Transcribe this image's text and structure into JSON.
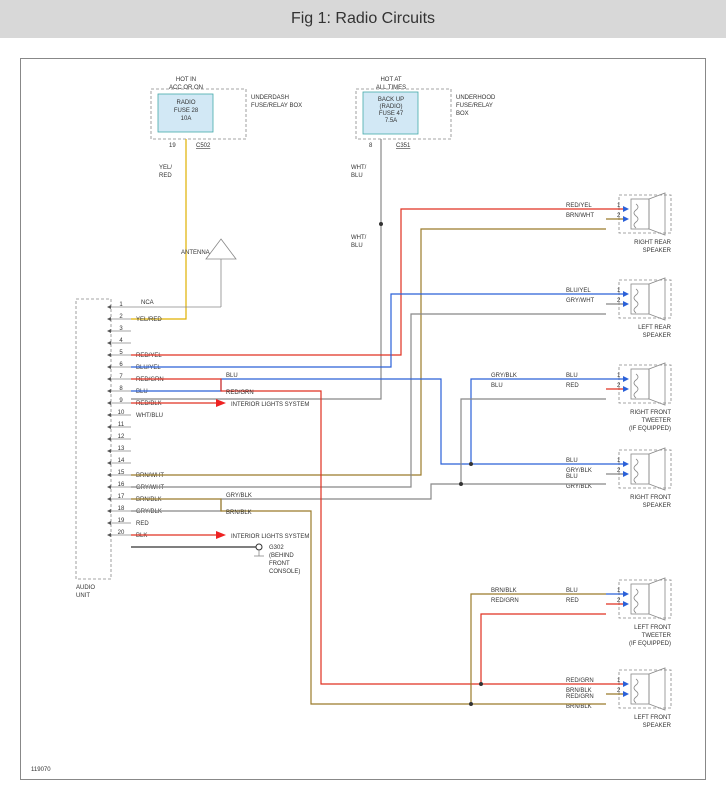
{
  "title": "Fig 1: Radio Circuits",
  "diagram_id": "119070",
  "fuse1": {
    "header": "HOT IN\nACC OR ON",
    "name": "RADIO",
    "fuse": "FUSE 28",
    "rating": "10A",
    "conn": "C502",
    "conn_pin": "19",
    "box_label": "UNDERDASH\nFUSE/RELAY BOX"
  },
  "fuse2": {
    "header": "HOT AT\nALL TIMES",
    "name": "BACK UP",
    "sub": "(RADIO)",
    "fuse": "FUSE 47",
    "rating": "7.5A",
    "conn": "C351",
    "conn_pin": "8",
    "box_label": "UNDERHOOD\nFUSE/RELAY\nBOX"
  },
  "antenna_label": "ANTENNA",
  "antenna_wire": "NCA",
  "audio_unit": "AUDIO\nUNIT",
  "ground": {
    "id": "G302",
    "loc": "(BEHIND\nFRONT\nCONSOLE)"
  },
  "interior_lights": "INTERIOR LIGHTS SYSTEM",
  "pins": [
    {
      "n": "1",
      "label": "",
      "color": ""
    },
    {
      "n": "2",
      "label": "YEL/RED",
      "color": "#e0b000"
    },
    {
      "n": "3",
      "label": "",
      "color": ""
    },
    {
      "n": "4",
      "label": "",
      "color": ""
    },
    {
      "n": "5",
      "label": "RED/YEL",
      "color": "#e03020"
    },
    {
      "n": "6",
      "label": "BLU/YEL",
      "color": "#2a60d8"
    },
    {
      "n": "7",
      "label": "RED/GRN",
      "color": "#e03020"
    },
    {
      "n": "8",
      "label": "BLU",
      "color": "#2a60d8"
    },
    {
      "n": "9",
      "label": "RED/BLK",
      "color": "#e03020"
    },
    {
      "n": "10",
      "label": "WHT/BLU",
      "color": "#888"
    },
    {
      "n": "11",
      "label": "",
      "color": ""
    },
    {
      "n": "12",
      "label": "",
      "color": ""
    },
    {
      "n": "13",
      "label": "",
      "color": ""
    },
    {
      "n": "14",
      "label": "",
      "color": ""
    },
    {
      "n": "15",
      "label": "BRN/WHT",
      "color": "#9b7b2a"
    },
    {
      "n": "16",
      "label": "GRY/WHT",
      "color": "#888"
    },
    {
      "n": "17",
      "label": "BRN/BLK",
      "color": "#9b7b2a"
    },
    {
      "n": "18",
      "label": "GRY/BLK",
      "color": "#888"
    },
    {
      "n": "19",
      "label": "RED",
      "color": "#e03020"
    },
    {
      "n": "20",
      "label": "BLK",
      "color": "#333"
    }
  ],
  "crossover": {
    "p7": "BLU",
    "p8": "RED/GRN"
  },
  "speakers": [
    {
      "id": "rr",
      "name": "RIGHT REAR\nSPEAKER",
      "pin1_label": "RED/YEL",
      "pin1_color": "#e03020",
      "pin2_label": "BRN/WHT",
      "pin2_color": "#9b7b2a"
    },
    {
      "id": "lr",
      "name": "LEFT REAR\nSPEAKER",
      "pin1_label": "BLU/YEL",
      "pin1_color": "#2a60d8",
      "pin2_label": "GRY/WHT",
      "pin2_color": "#888"
    },
    {
      "id": "rft",
      "name": "RIGHT FRONT\nTWEETER\n(IF EQUIPPED)",
      "pin1_label": "BLU",
      "pin1_color": "#2a60d8",
      "pin2_label": "RED",
      "pin2_color": "#e03020",
      "in1": "GRY/BLK",
      "in2": "BLU"
    },
    {
      "id": "rf",
      "name": "RIGHT FRONT\nSPEAKER",
      "pin1_label": "BLU",
      "pin1_color": "#2a60d8",
      "pin2_label": "GRY/BLK",
      "pin2_color": "#888",
      "extra1": "BLU",
      "extra2": "GRY/BLK"
    },
    {
      "id": "lft",
      "name": "LEFT FRONT\nTWEETER\n(IF EQUIPPED)",
      "pin1_label": "BLU",
      "pin1_color": "#2a60d8",
      "pin2_label": "RED",
      "pin2_color": "#e03020",
      "in1": "BRN/BLK",
      "in2": "RED/GRN"
    },
    {
      "id": "lf",
      "name": "LEFT FRONT\nSPEAKER",
      "pin1_label": "RED/GRN",
      "pin1_color": "#e03020",
      "pin2_label": "BRN/BLK",
      "pin2_color": "#9b7b2a",
      "extra1": "RED/GRN",
      "extra2": "BRN/BLK"
    }
  ],
  "wire_fuse1": "YEL/\nRED",
  "wire_fuse2": "WHT/\nBLU",
  "wire_fuse2b": "WHT/\nBLU",
  "p17_out": "GRY/BLK",
  "p18_out": "BRN/BLK"
}
